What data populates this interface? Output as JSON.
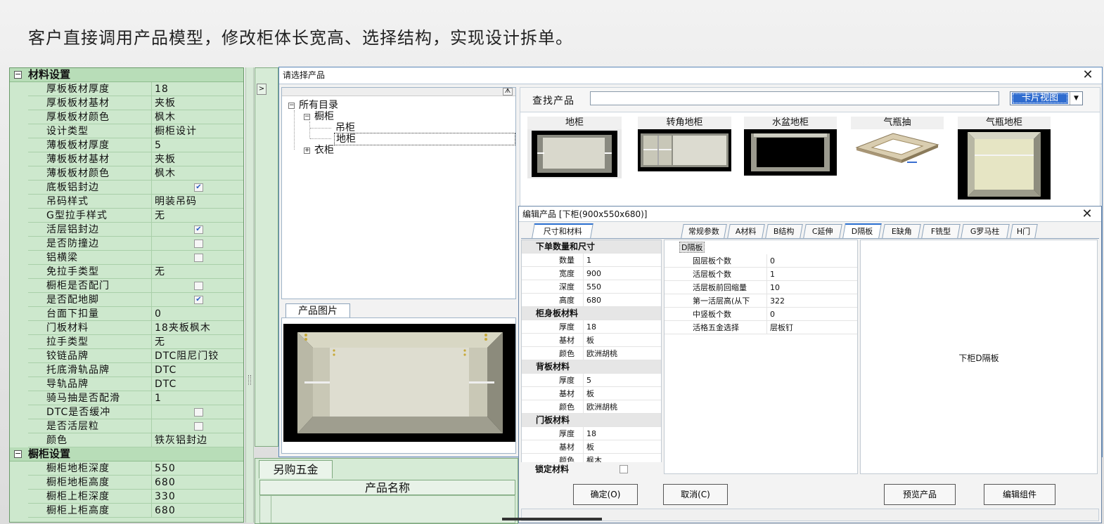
{
  "headline": "客户直接调用产品模型，修改柜体长宽高、选择结构，实现设计拆单。",
  "property_panel": {
    "sections": [
      {
        "title": "材料设置",
        "rows": [
          {
            "key": "厚板板材厚度",
            "value": "18"
          },
          {
            "key": "厚板板材基材",
            "value": "夹板"
          },
          {
            "key": "厚板板材颜色",
            "value": "枫木"
          },
          {
            "key": "设计类型",
            "value": "橱柜设计"
          },
          {
            "key": "薄板板材厚度",
            "value": "5"
          },
          {
            "key": "薄板板材基材",
            "value": "夹板"
          },
          {
            "key": "薄板板材颜色",
            "value": "枫木"
          },
          {
            "key": "底板铝封边",
            "checked": true
          },
          {
            "key": "吊码样式",
            "value": "明装吊码"
          },
          {
            "key": "G型拉手样式",
            "value": "无"
          },
          {
            "key": "活层铝封边",
            "checked": true
          },
          {
            "key": "是否防撞边",
            "checked": false
          },
          {
            "key": "铝横梁",
            "checked": false
          },
          {
            "key": "免拉手类型",
            "value": "无"
          },
          {
            "key": "橱柜是否配门",
            "checked": false
          },
          {
            "key": "是否配地脚",
            "checked": true
          },
          {
            "key": "台面下扣量",
            "value": "0"
          },
          {
            "key": "门板材料",
            "value": "18夹板枫木"
          },
          {
            "key": "拉手类型",
            "value": "无"
          },
          {
            "key": "铰链品牌",
            "value": "DTC阻尼门铰"
          },
          {
            "key": "托底滑轨品牌",
            "value": "DTC"
          },
          {
            "key": "导轨品牌",
            "value": "DTC"
          },
          {
            "key": "骑马抽是否配滑",
            "value": "1"
          },
          {
            "key": "DTC是否缓冲",
            "checked": false
          },
          {
            "key": "是否活层粒",
            "checked": false
          },
          {
            "key": "颜色",
            "value": "铁灰铝封边"
          }
        ]
      },
      {
        "title": "橱柜设置",
        "rows": [
          {
            "key": "橱柜地柜深度",
            "value": "550"
          },
          {
            "key": "橱柜地柜高度",
            "value": "680"
          },
          {
            "key": "橱柜上柜深度",
            "value": "330"
          },
          {
            "key": "橱柜上柜高度",
            "value": "680"
          }
        ]
      }
    ]
  },
  "background_app": {
    "tab_label": "另购五金",
    "column_header": "产品名称"
  },
  "select_dialog": {
    "title": "请选择产品",
    "close": "✕",
    "tree": {
      "root": "所有目录",
      "cabinet": "橱柜",
      "wall": "吊柜",
      "base": "地柜",
      "wardrobe": "衣柜"
    },
    "image_tab": "产品图片",
    "search_label": "查找产品",
    "search_value": "",
    "view_mode": "卡片视图",
    "cards": [
      "地柜",
      "转角地柜",
      "水盆地柜",
      "气瓶抽",
      "气瓶地柜"
    ]
  },
  "edit_dialog": {
    "title": "编辑产品 [下柜(900x550x680)]",
    "close": "✕",
    "left_tab": "尺寸和材料",
    "tabs": [
      "常规参数",
      "A材料",
      "B结构",
      "C延伸",
      "D隔板",
      "E缺角",
      "F铣型",
      "G罗马柱",
      "H门"
    ],
    "size_grid": {
      "sections": [
        {
          "title": "下单数量和尺寸",
          "rows": [
            {
              "k": "数量",
              "v": "1"
            },
            {
              "k": "宽度",
              "v": "900"
            },
            {
              "k": "深度",
              "v": "550"
            },
            {
              "k": "高度",
              "v": "680"
            }
          ]
        },
        {
          "title": "柜身板材料",
          "rows": [
            {
              "k": "厚度",
              "v": "18"
            },
            {
              "k": "基材",
              "v": "板"
            },
            {
              "k": "颜色",
              "v": "欧洲胡桃"
            }
          ]
        },
        {
          "title": "背板材料",
          "rows": [
            {
              "k": "厚度",
              "v": "5"
            },
            {
              "k": "基材",
              "v": "板"
            },
            {
              "k": "颜色",
              "v": "欧洲胡桃"
            }
          ]
        },
        {
          "title": "门板材料",
          "rows": [
            {
              "k": "厚度",
              "v": "18"
            },
            {
              "k": "基材",
              "v": "板"
            },
            {
              "k": "颜色",
              "v": "枫木"
            }
          ]
        }
      ],
      "lock_label": "锁定材料"
    },
    "d_grid": {
      "header": "D隔板",
      "rows": [
        {
          "k": "固层板个数",
          "v": "0"
        },
        {
          "k": "活层板个数",
          "v": "1"
        },
        {
          "k": "活层板前回缩量",
          "v": "10"
        },
        {
          "k": "第一活层高(从下",
          "v": "322"
        },
        {
          "k": "中竖板个数",
          "v": "0"
        },
        {
          "k": "活格五金选择",
          "v": "层板钉"
        }
      ]
    },
    "preview_caption": "下柜D隔板",
    "buttons": {
      "ok": "确定(O)",
      "cancel": "取消(C)",
      "preview": "预览产品",
      "edit": "编辑组件"
    }
  }
}
